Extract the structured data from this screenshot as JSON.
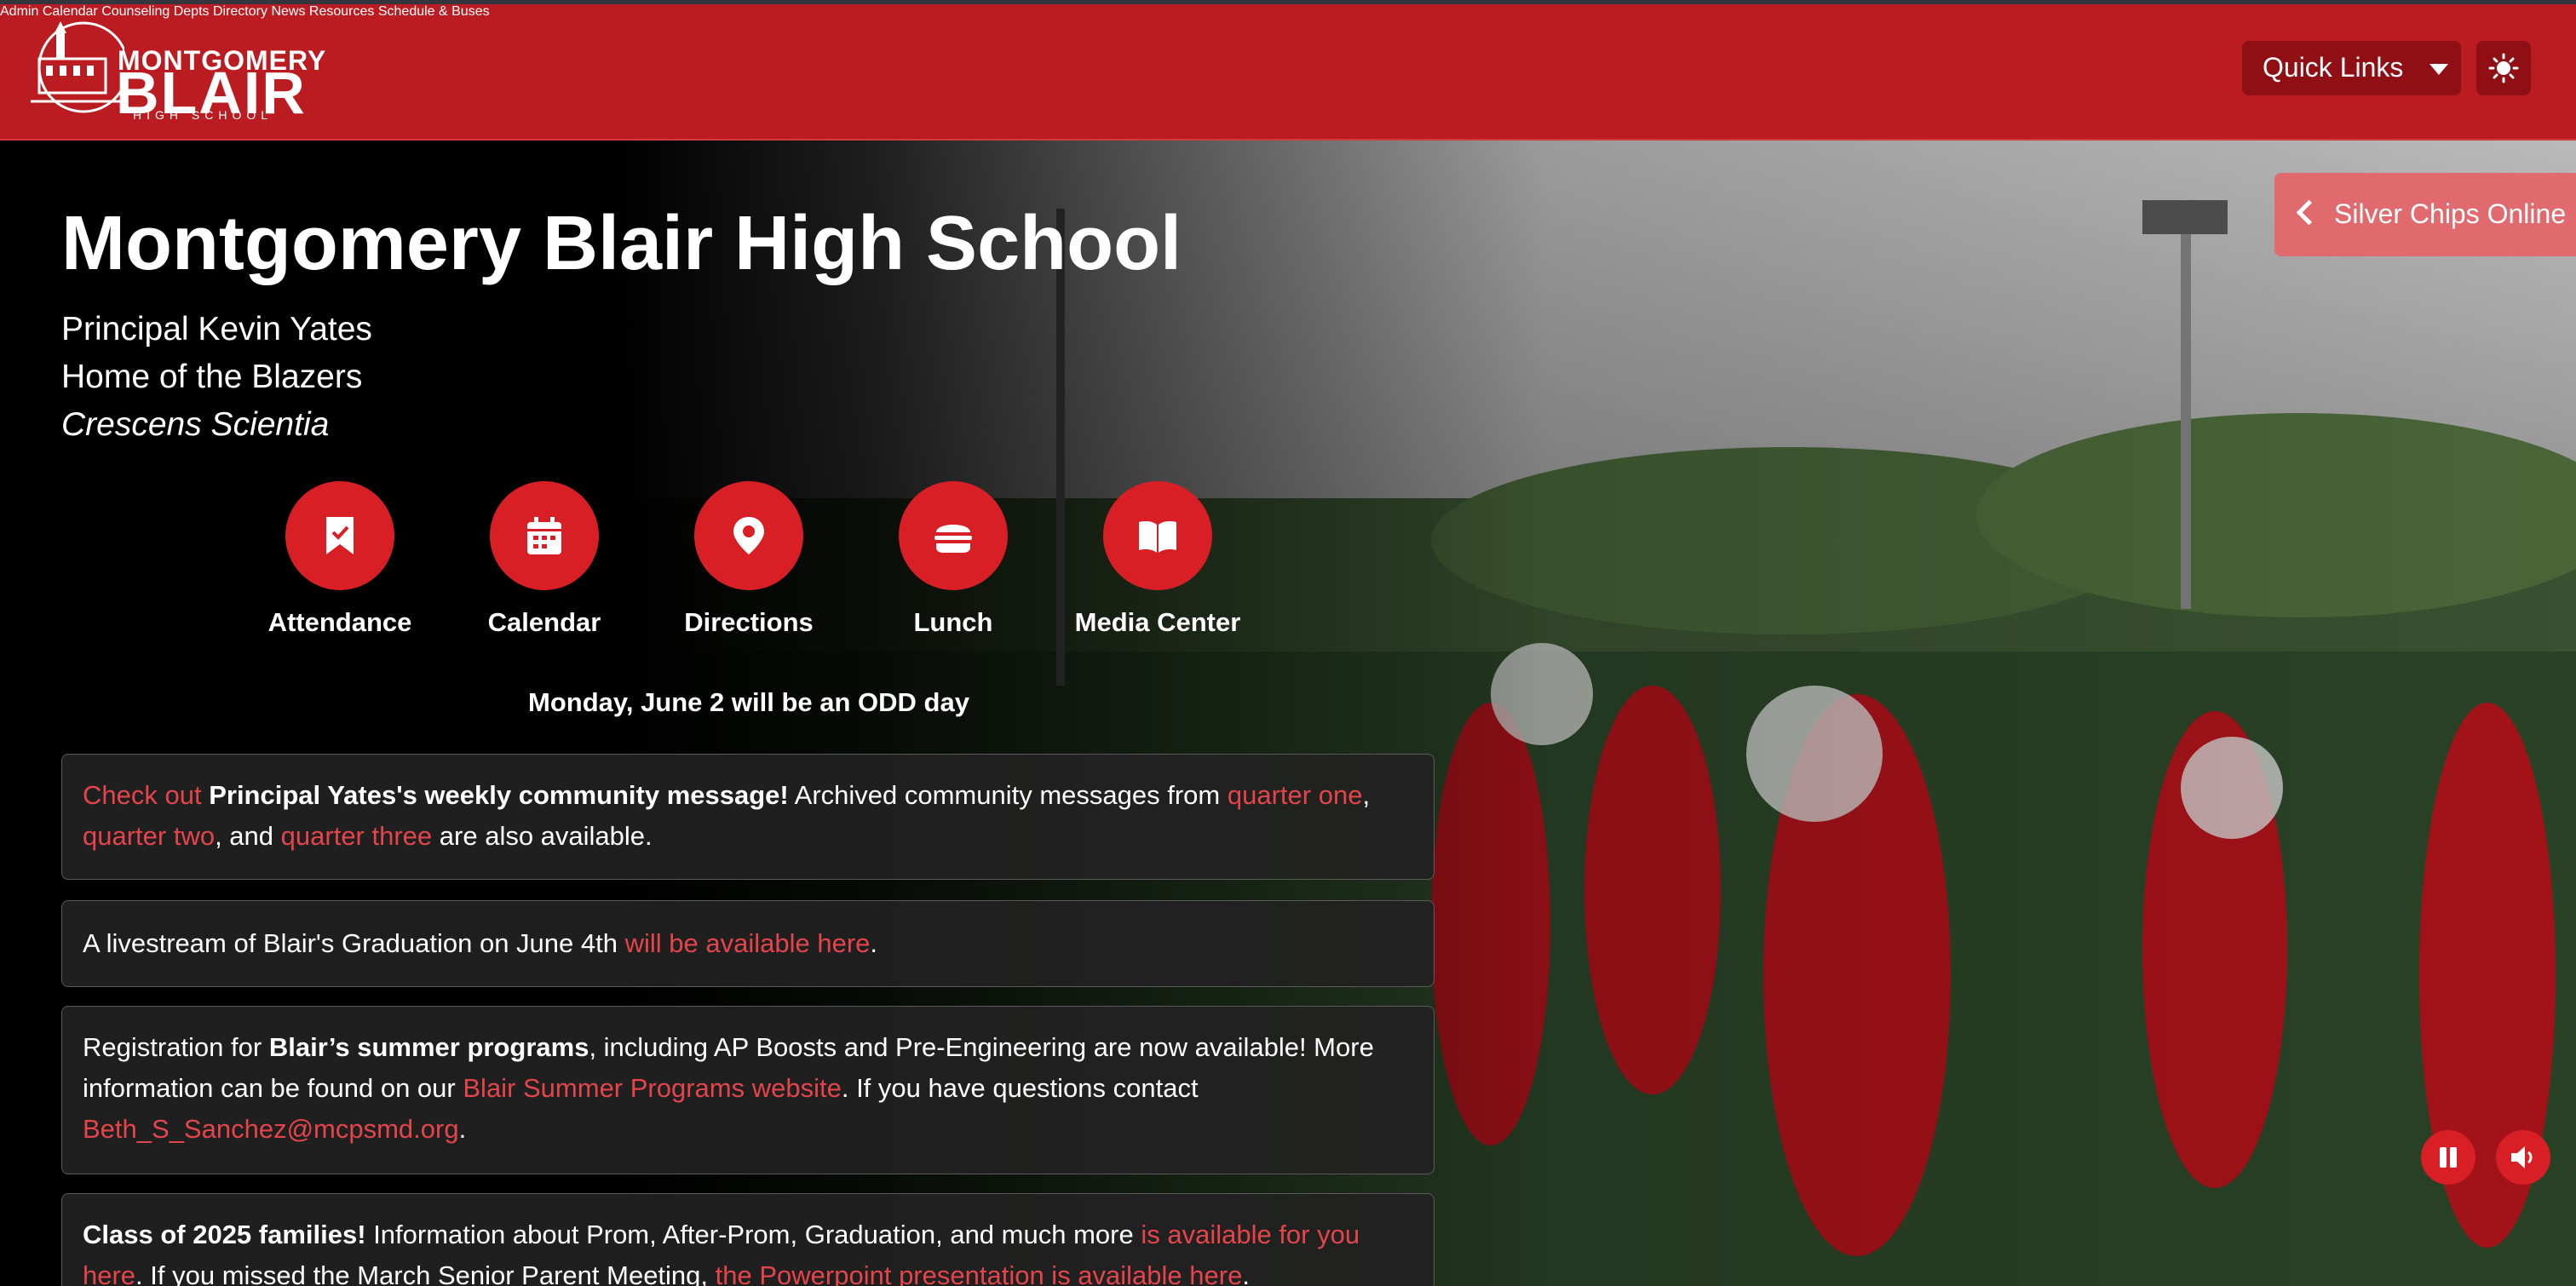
{
  "header": {
    "logo_line1": "MONTGOMERY",
    "logo_line2": "BLAIR",
    "logo_line3": "HIGH SCHOOL",
    "nav": [
      "Admin",
      "Calendar",
      "Counseling",
      "Depts",
      "Directory",
      "News",
      "Resources",
      "Schedule & Buses"
    ],
    "quick_links_label": "Quick Links",
    "theme_icon": "sun-icon"
  },
  "hero": {
    "title": "Montgomery Blair High School",
    "principal": "Principal Kevin Yates",
    "home": "Home of the Blazers",
    "motto": "Crescens Scientia",
    "quick_buttons": [
      {
        "label": "Attendance",
        "icon": "bookmark-check-icon"
      },
      {
        "label": "Calendar",
        "icon": "calendar-icon"
      },
      {
        "label": "Directions",
        "icon": "map-pin-icon"
      },
      {
        "label": "Lunch",
        "icon": "burger-icon"
      },
      {
        "label": "Media Center",
        "icon": "book-icon"
      }
    ],
    "odd_day": "Monday, June 2 will be an ODD day",
    "silver_chips": "Silver Chips Online",
    "pause_icon": "pause-icon",
    "volume_icon": "volume-icon"
  },
  "announcements": {
    "a1": {
      "link_check": "Check out",
      "bold": "Principal Yates's weekly community message!",
      "text1": "Archived community messages from",
      "link_q1": "quarter one",
      "comma": ",",
      "link_q2": "quarter two",
      "and": ", and",
      "link_q3": "quarter three",
      "end": "are also available."
    },
    "a2": {
      "text": "A livestream of Blair's Graduation on June 4th",
      "link": "will be available here",
      "end": "."
    },
    "a3": {
      "text1": "Registration for",
      "bold": "Blair’s summer programs",
      "text2": ", including AP Boosts and Pre-Engineering are now available! More information can be found on our",
      "link": "Blair Summer Programs website",
      "text3": ". If you have questions contact",
      "email": "Beth_S_Sanchez@mcpsmd.org",
      "end": "."
    },
    "a4": {
      "bold": "Class of 2025 families!",
      "text1": "Information about Prom, After-Prom, Graduation, and much more",
      "link1": "is available for you here",
      "text2": ". If you missed the March Senior Parent Meeting,",
      "link2": "the Powerpoint presentation is available here",
      "end": "."
    }
  },
  "colors": {
    "brand_red": "#bb1c21",
    "accent_red": "#d81f26",
    "link_red": "#e5454a"
  }
}
